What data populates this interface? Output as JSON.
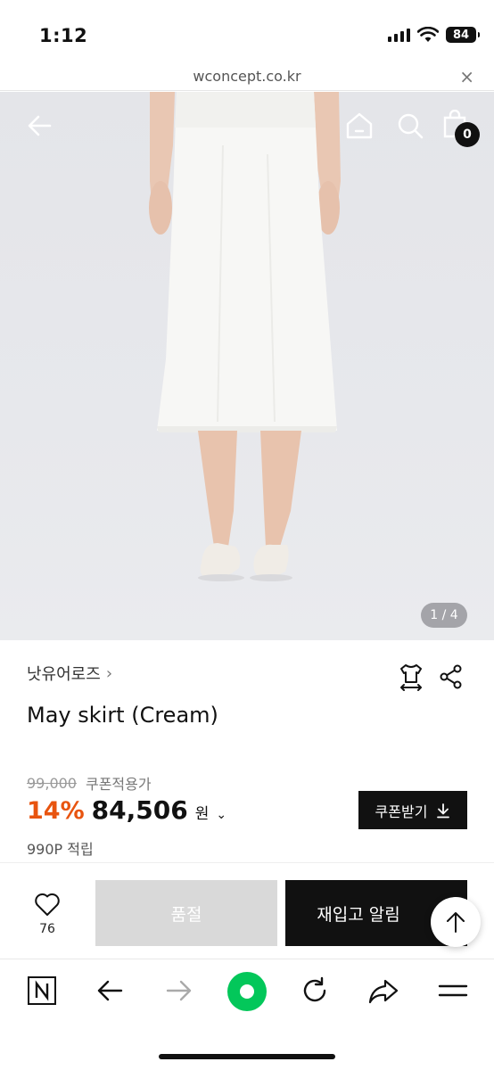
{
  "status_bar": {
    "time": "1:12",
    "battery": "84"
  },
  "url_bar": {
    "url": "wconcept.co.kr",
    "close": "×"
  },
  "image": {
    "counter": "1 / 4",
    "cart_count": "0"
  },
  "product": {
    "brand": "낫유어로즈",
    "brand_chevron": "›",
    "title": "May skirt (Cream)",
    "original_price": "99,000",
    "coupon_label": "쿠폰적용가",
    "discount": "14%",
    "price": "84,506",
    "currency": "원",
    "price_chevron": "⌄",
    "coupon_button": "쿠폰받기",
    "points": "990P 적립"
  },
  "actions": {
    "wish_count": "76",
    "soldout_label": "품절",
    "restock_label": "재입고 알림"
  },
  "colors": {
    "accent": "#e8540f",
    "naver_green": "#03c75a",
    "dark": "#111111"
  }
}
